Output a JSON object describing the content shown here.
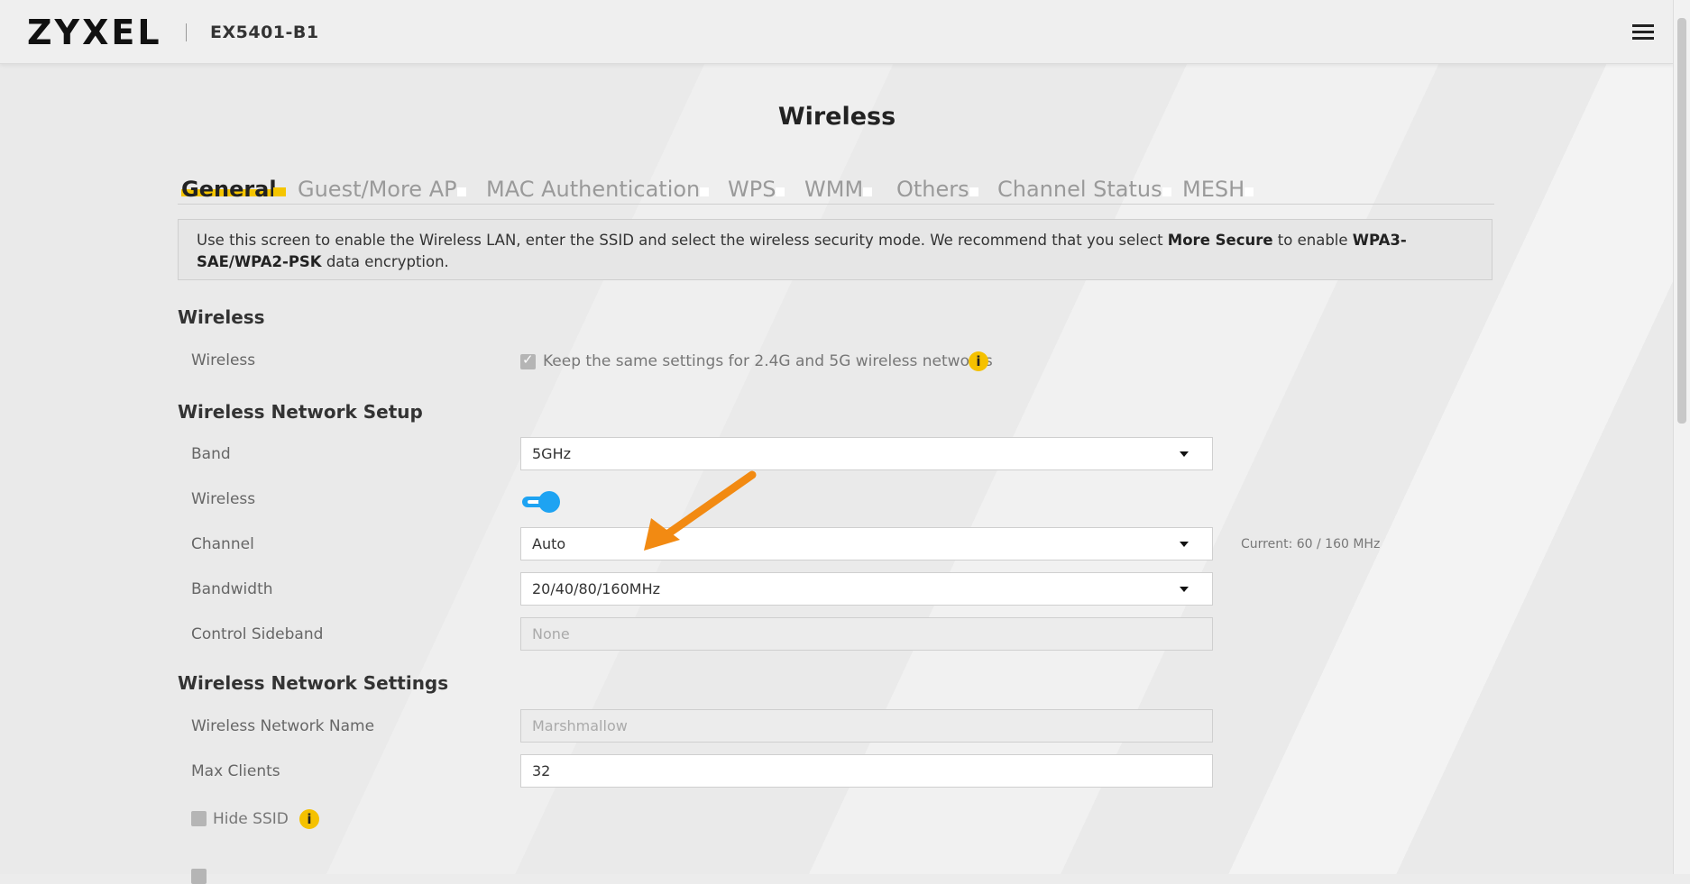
{
  "header": {
    "brand": "ZYXEL",
    "model": "EX5401-B1",
    "menu_icon": "hamburger-menu-icon"
  },
  "page": {
    "title": "Wireless"
  },
  "tabs": [
    {
      "label": "General",
      "active": true
    },
    {
      "label": "Guest/More AP",
      "active": false
    },
    {
      "label": "MAC Authentication",
      "active": false
    },
    {
      "label": "WPS",
      "active": false
    },
    {
      "label": "WMM",
      "active": false
    },
    {
      "label": "Others",
      "active": false
    },
    {
      "label": "Channel Status",
      "active": false
    },
    {
      "label": "MESH",
      "active": false
    }
  ],
  "notice": {
    "text_1": "Use this screen to enable the Wireless LAN, enter the SSID and select the wireless security mode. We recommend that you select ",
    "bold_1": "More Secure",
    "text_2": " to enable ",
    "bold_2": "WPA3-SAE/WPA2-PSK",
    "text_3": " data encryption."
  },
  "wireless_section": {
    "title": "Wireless",
    "wireless_label": "Wireless",
    "keep_same_checked": true,
    "keep_same_label": "Keep the same settings for 2.4G and 5G wireless networks",
    "info_icon": "info-icon"
  },
  "network_setup": {
    "title": "Wireless Network Setup",
    "band_label": "Band",
    "band_value": "5GHz",
    "wireless_label": "Wireless",
    "wireless_enabled": true,
    "channel_label": "Channel",
    "channel_value": "Auto",
    "channel_current": "Current: 60 / 160 MHz",
    "bandwidth_label": "Bandwidth",
    "bandwidth_value": "20/40/80/160MHz",
    "sideband_label": "Control Sideband",
    "sideband_value": "None"
  },
  "network_settings": {
    "title": "Wireless Network Settings",
    "name_label": "Wireless Network Name",
    "name_value": "Marshmallow",
    "max_clients_label": "Max Clients",
    "max_clients_value": "32",
    "hide_ssid_label": "Hide SSID",
    "hide_ssid_checked": false
  },
  "colors": {
    "accent_yellow": "#f5c500",
    "toggle_blue": "#1ea3f2",
    "annotation_orange": "#f28a12"
  }
}
